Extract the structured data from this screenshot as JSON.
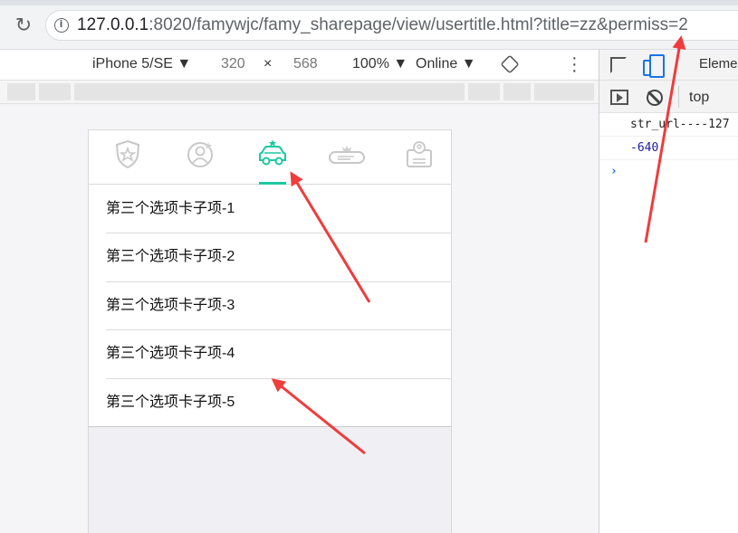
{
  "browser": {
    "url_host": "127.0.0.1",
    "url_rest": ":8020/famywjc/famy_sharepage/view/usertitle.html?title=zz&permiss=2"
  },
  "device_toolbar": {
    "device": "iPhone 5/SE ▼",
    "width": "320",
    "times": "×",
    "height": "568",
    "zoom": "100% ▼",
    "network": "Online ▼"
  },
  "devtools": {
    "panel_tab": "Eleme",
    "context": "top",
    "console_lines": [
      "str_url----127",
      "-640"
    ],
    "prompt": "›"
  },
  "page": {
    "tabs": [
      {
        "icon": "shield-star-icon"
      },
      {
        "icon": "user-circle-icon"
      },
      {
        "icon": "car-icon",
        "active": true
      },
      {
        "icon": "hat-icon"
      },
      {
        "icon": "id-card-icon"
      }
    ],
    "active_color": "#1ac8a0",
    "list_items": [
      "第三个选项卡子项-1",
      "第三个选项卡子项-2",
      "第三个选项卡子项-3",
      "第三个选项卡子项-4",
      "第三个选项卡子项-5"
    ]
  }
}
